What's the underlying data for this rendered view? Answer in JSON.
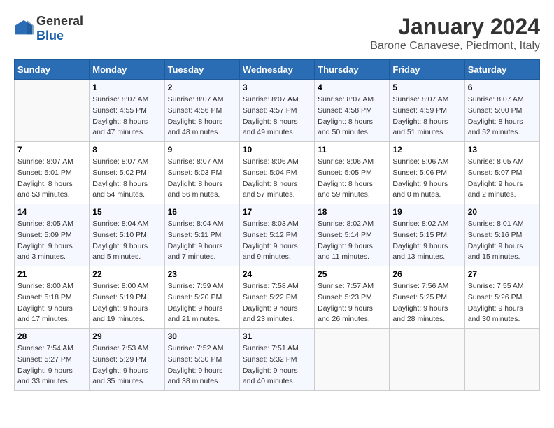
{
  "header": {
    "logo_general": "General",
    "logo_blue": "Blue",
    "title": "January 2024",
    "subtitle": "Barone Canavese, Piedmont, Italy"
  },
  "weekdays": [
    "Sunday",
    "Monday",
    "Tuesday",
    "Wednesday",
    "Thursday",
    "Friday",
    "Saturday"
  ],
  "weeks": [
    [
      {
        "day": null
      },
      {
        "day": "1",
        "sunrise": "8:07 AM",
        "sunset": "4:55 PM",
        "daylight": "8 hours and 47 minutes."
      },
      {
        "day": "2",
        "sunrise": "8:07 AM",
        "sunset": "4:56 PM",
        "daylight": "8 hours and 48 minutes."
      },
      {
        "day": "3",
        "sunrise": "8:07 AM",
        "sunset": "4:57 PM",
        "daylight": "8 hours and 49 minutes."
      },
      {
        "day": "4",
        "sunrise": "8:07 AM",
        "sunset": "4:58 PM",
        "daylight": "8 hours and 50 minutes."
      },
      {
        "day": "5",
        "sunrise": "8:07 AM",
        "sunset": "4:59 PM",
        "daylight": "8 hours and 51 minutes."
      },
      {
        "day": "6",
        "sunrise": "8:07 AM",
        "sunset": "5:00 PM",
        "daylight": "8 hours and 52 minutes."
      }
    ],
    [
      {
        "day": "7",
        "sunrise": "8:07 AM",
        "sunset": "5:01 PM",
        "daylight": "8 hours and 53 minutes."
      },
      {
        "day": "8",
        "sunrise": "8:07 AM",
        "sunset": "5:02 PM",
        "daylight": "8 hours and 54 minutes."
      },
      {
        "day": "9",
        "sunrise": "8:07 AM",
        "sunset": "5:03 PM",
        "daylight": "8 hours and 56 minutes."
      },
      {
        "day": "10",
        "sunrise": "8:06 AM",
        "sunset": "5:04 PM",
        "daylight": "8 hours and 57 minutes."
      },
      {
        "day": "11",
        "sunrise": "8:06 AM",
        "sunset": "5:05 PM",
        "daylight": "8 hours and 59 minutes."
      },
      {
        "day": "12",
        "sunrise": "8:06 AM",
        "sunset": "5:06 PM",
        "daylight": "9 hours and 0 minutes."
      },
      {
        "day": "13",
        "sunrise": "8:05 AM",
        "sunset": "5:07 PM",
        "daylight": "9 hours and 2 minutes."
      }
    ],
    [
      {
        "day": "14",
        "sunrise": "8:05 AM",
        "sunset": "5:09 PM",
        "daylight": "9 hours and 3 minutes."
      },
      {
        "day": "15",
        "sunrise": "8:04 AM",
        "sunset": "5:10 PM",
        "daylight": "9 hours and 5 minutes."
      },
      {
        "day": "16",
        "sunrise": "8:04 AM",
        "sunset": "5:11 PM",
        "daylight": "9 hours and 7 minutes."
      },
      {
        "day": "17",
        "sunrise": "8:03 AM",
        "sunset": "5:12 PM",
        "daylight": "9 hours and 9 minutes."
      },
      {
        "day": "18",
        "sunrise": "8:02 AM",
        "sunset": "5:14 PM",
        "daylight": "9 hours and 11 minutes."
      },
      {
        "day": "19",
        "sunrise": "8:02 AM",
        "sunset": "5:15 PM",
        "daylight": "9 hours and 13 minutes."
      },
      {
        "day": "20",
        "sunrise": "8:01 AM",
        "sunset": "5:16 PM",
        "daylight": "9 hours and 15 minutes."
      }
    ],
    [
      {
        "day": "21",
        "sunrise": "8:00 AM",
        "sunset": "5:18 PM",
        "daylight": "9 hours and 17 minutes."
      },
      {
        "day": "22",
        "sunrise": "8:00 AM",
        "sunset": "5:19 PM",
        "daylight": "9 hours and 19 minutes."
      },
      {
        "day": "23",
        "sunrise": "7:59 AM",
        "sunset": "5:20 PM",
        "daylight": "9 hours and 21 minutes."
      },
      {
        "day": "24",
        "sunrise": "7:58 AM",
        "sunset": "5:22 PM",
        "daylight": "9 hours and 23 minutes."
      },
      {
        "day": "25",
        "sunrise": "7:57 AM",
        "sunset": "5:23 PM",
        "daylight": "9 hours and 26 minutes."
      },
      {
        "day": "26",
        "sunrise": "7:56 AM",
        "sunset": "5:25 PM",
        "daylight": "9 hours and 28 minutes."
      },
      {
        "day": "27",
        "sunrise": "7:55 AM",
        "sunset": "5:26 PM",
        "daylight": "9 hours and 30 minutes."
      }
    ],
    [
      {
        "day": "28",
        "sunrise": "7:54 AM",
        "sunset": "5:27 PM",
        "daylight": "9 hours and 33 minutes."
      },
      {
        "day": "29",
        "sunrise": "7:53 AM",
        "sunset": "5:29 PM",
        "daylight": "9 hours and 35 minutes."
      },
      {
        "day": "30",
        "sunrise": "7:52 AM",
        "sunset": "5:30 PM",
        "daylight": "9 hours and 38 minutes."
      },
      {
        "day": "31",
        "sunrise": "7:51 AM",
        "sunset": "5:32 PM",
        "daylight": "9 hours and 40 minutes."
      },
      {
        "day": null
      },
      {
        "day": null
      },
      {
        "day": null
      }
    ]
  ],
  "labels": {
    "sunrise": "Sunrise:",
    "sunset": "Sunset:",
    "daylight": "Daylight:"
  }
}
